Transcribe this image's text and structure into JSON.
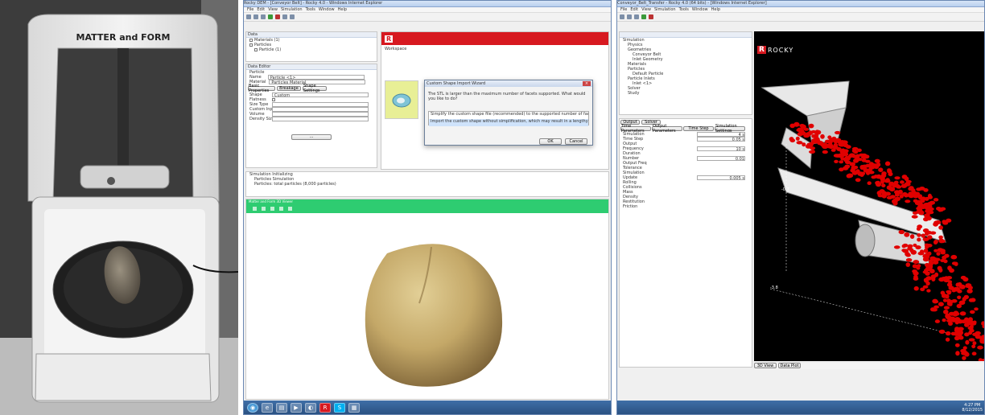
{
  "photo": {
    "scanner_brand": "MATTER and FORM"
  },
  "left_app": {
    "window_title": "Rocky DEM - [Conveyor Belt] - Rocky 4.0 - Windows Internet Explorer",
    "menu": [
      "File",
      "Edit",
      "View",
      "Simulation",
      "Tools",
      "Window",
      "Help"
    ],
    "project_tree_items": [
      "Materials (1)",
      "Particles",
      "Particle (1)"
    ],
    "data_editor_title": "Data Editor",
    "data_editor_tab": "Particle",
    "name_label": "Name",
    "name_value": "Particle <1>",
    "material_label": "Material",
    "material_value": "Particles Material",
    "sub_tabs": [
      "Basic Properties",
      "Breakage",
      "Shape Settings"
    ],
    "fields": [
      "Shape",
      "Flatness",
      "Size Type",
      "Custom Input",
      "Volume",
      "Density Size"
    ],
    "shape_value": "Custom",
    "workspace_label": "Workspace",
    "dialog": {
      "title": "Custom Shape Import Wizard",
      "question": "The STL is larger than the maximum number of facets supported. What would you like to do?",
      "option1": "Simplify the custom shape file (recommended) to the supported number of facets",
      "option2": "Import the custom shape without simplification, which may result in a lengthy setup",
      "ok": "OK",
      "cancel": "Cancel"
    },
    "log_items": [
      "Simulation Initializing",
      "Particles Simulation",
      "Particles: total particles (8,000 particles)"
    ],
    "viewer_title": "Matter and Form 3D Viewer",
    "taskbar_apps": [
      "IE",
      "Folder",
      "Media",
      "Chrome",
      "Rocky",
      "Skype",
      "Notes"
    ]
  },
  "right_app": {
    "window_title": "Conveyor_Belt_Transfer - Rocky 4.0 (64 bits) - [Windows Internet Explorer]",
    "menu": [
      "File",
      "Edit",
      "View",
      "Simulation",
      "Tools",
      "Window",
      "Help"
    ],
    "tree_items": [
      "Simulation",
      "Physics",
      "Geometries",
      "Conveyor Belt",
      "Inlet Geometry",
      "Materials",
      "Particles",
      "Default Particle",
      "Particle Inlets",
      "Inlet <1>",
      "Solver",
      "Study"
    ],
    "editor_tabs": [
      "Output",
      "Solver"
    ],
    "editor_subtabs": [
      "Time Parameters",
      "Output Parameters",
      "Time Step",
      "Simulation Settings"
    ],
    "param_labels": [
      "Simulation",
      "Time Step",
      "Output",
      "Frequency",
      "Duration",
      "Number",
      "Output Freq",
      "Tolerance",
      "Simulation",
      "Update",
      "Rolling",
      "Collisions",
      "Mass",
      "Density",
      "Restitution",
      "Friction"
    ],
    "param_values": [
      "4 s",
      "0.05 s",
      "",
      "10 s",
      "",
      "0.01",
      "",
      "",
      "",
      "0.005 s",
      ""
    ],
    "viewport_logo": "ROCKY",
    "axis_labels": [
      "-0.7",
      "-3.8"
    ],
    "bottom_tabs": [
      "3D View",
      "Data Plot"
    ],
    "clock_time": "4:27 PM",
    "clock_date": "8/12/2015"
  },
  "colors": {
    "particle_red": "#e00000",
    "rocky_red": "#d71920",
    "viewer_green": "#2ecc71",
    "taskbar_blue": "#2f5f95"
  }
}
